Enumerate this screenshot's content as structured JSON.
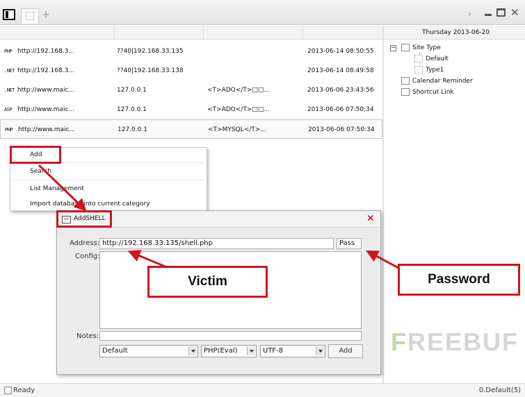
{
  "header": {
    "date": "Thursday  2013-06-20"
  },
  "rows": [
    {
      "type": "PHP",
      "url": "http://192.168.3...",
      "ip": "??40|192.168.33.135",
      "db": "",
      "time": "2013-06-14 08:50:55"
    },
    {
      "type": ".NET",
      "url": "http://192.168.3...",
      "ip": "??40|192.168.33.138",
      "db": "",
      "time": "2013-06-14 08:49:58"
    },
    {
      "type": ".NET",
      "url": "http://www.maic...",
      "ip": "127.0.0.1",
      "db": "<T>ADO</T>□□...",
      "time": "2013-06-06 23:43:56"
    },
    {
      "type": "ASP",
      "url": "http://www.maic...",
      "ip": "127.0.0.1",
      "db": "<T>ADO</T>□□...",
      "time": "2013-06-06 07:50:34"
    },
    {
      "type": "PHP",
      "url": "http://www.maic...",
      "ip": "127.0.0.1",
      "db": "<T>MYSQL</T>...",
      "time": "2013-06-06 07:50:34"
    }
  ],
  "tree": {
    "root": "Site Type",
    "children": [
      "Default",
      "Type1"
    ],
    "calendar": "Calendar Reminder",
    "shortcut": "Shortcut Link"
  },
  "context_menu": {
    "items": [
      "Add",
      "Search",
      "List Management",
      "Import database into current category"
    ]
  },
  "dialog": {
    "title": "AddSHELL",
    "address_label": "Address:",
    "address_value": "http://192.168.33.135/shell.php",
    "password_value": "Pass",
    "config_label": "Config:",
    "notes_label": "Notes:",
    "category_select": "Default",
    "script_select": "PHP(Eval)",
    "encoding_select": "UTF-8",
    "add_button": "Add"
  },
  "annotations": {
    "victim": "Victim",
    "password": "Password",
    "color": "#d0141e"
  },
  "watermark": {
    "first": "F",
    "rest": "REEBUF"
  },
  "status": {
    "left": "Ready",
    "right": "0.Default(5)"
  }
}
